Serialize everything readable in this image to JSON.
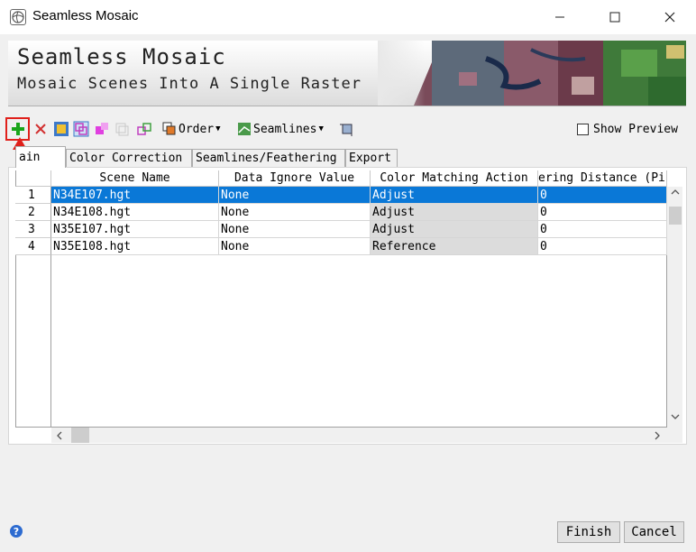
{
  "window": {
    "title": "Seamless Mosaic",
    "controls": [
      "minimize-icon",
      "maximize-icon",
      "close-icon"
    ]
  },
  "banner": {
    "title": "Seamless Mosaic",
    "subtitle": "Mosaic Scenes Into A Single Raster"
  },
  "toolbar": {
    "order_label": "Order",
    "seamlines_label": "Seamlines",
    "show_preview_label": "Show Preview",
    "show_preview_checked": false
  },
  "tabs": [
    {
      "label": "ain",
      "active": true
    },
    {
      "label": "Color Correction",
      "active": false
    },
    {
      "label": "Seamlines/Feathering",
      "active": false
    },
    {
      "label": "Export",
      "active": false
    }
  ],
  "table": {
    "columns": [
      "Scene Name",
      "Data Ignore Value",
      "Color Matching Action",
      "ering Distance (Pi"
    ],
    "rows": [
      {
        "num": "1",
        "scene": "N34E107.hgt",
        "ignore": "None",
        "action": "Adjust",
        "distance": "0",
        "selected": true
      },
      {
        "num": "2",
        "scene": "N34E108.hgt",
        "ignore": "None",
        "action": "Adjust",
        "distance": "0",
        "selected": false
      },
      {
        "num": "3",
        "scene": "N35E107.hgt",
        "ignore": "None",
        "action": "Adjust",
        "distance": "0",
        "selected": false
      },
      {
        "num": "4",
        "scene": "N35E108.hgt",
        "ignore": "None",
        "action": "Reference",
        "distance": "0",
        "selected": false
      }
    ]
  },
  "footer": {
    "finish_label": "Finish",
    "cancel_label": "Cancel"
  },
  "colors": {
    "selection": "#0a78d7",
    "annotation": "#e0201b",
    "add_icon": "#1aa51a"
  }
}
